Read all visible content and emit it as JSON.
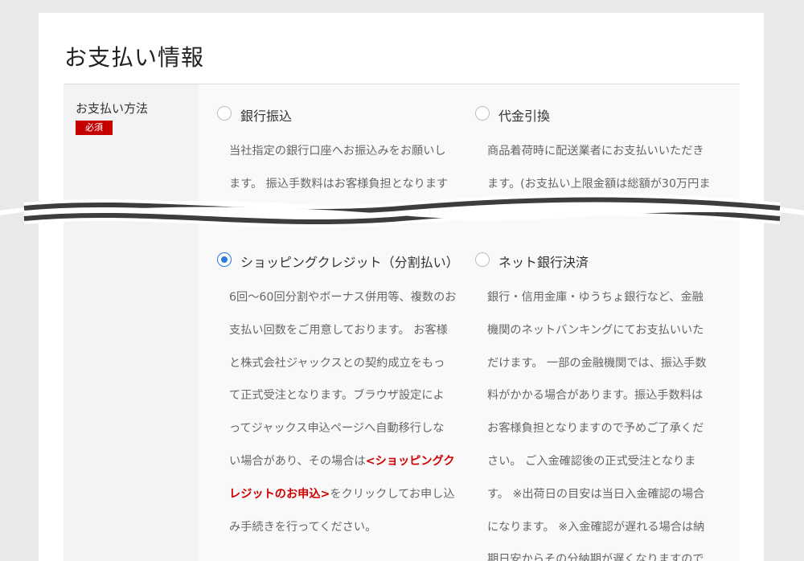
{
  "page": {
    "title": "お支払い情報"
  },
  "form": {
    "field_label": "お支払い方法",
    "required_badge": "必須"
  },
  "options": {
    "bank_transfer": {
      "title": "銀行振込",
      "checked": false,
      "desc": [
        "当社指定の銀行口座へお振込みをお願いし",
        "ます。 振込手数料はお客様負担となります"
      ]
    },
    "cod": {
      "title": "代金引換",
      "checked": false,
      "desc": [
        "商品着荷時に配送業者にお支払いいただき",
        "ます。(お支払い上限金額は総額が30万円ま"
      ]
    },
    "shopping_credit": {
      "title": "ショッピングクレジット（分割払い）",
      "checked": true,
      "desc": [
        "6回～60回分割やボーナス併用等、複数のお",
        "支払い回数をご用意しております。 お客様",
        "と株式会社ジャックスとの契約成立をもっ",
        "て正式受注となります。ブラウザ設定によ",
        "ってジャックス申込ページへ自動移行しな"
      ],
      "desc_line6_before": "い場合があり、その場合は",
      "link_part1": "<ショッピングク",
      "link_part2": "レジットのお申込>",
      "desc_line7_after": "をクリックしてお申し込",
      "desc_line8": "み手続きを行ってください。"
    },
    "net_bank": {
      "title": "ネット銀行決済",
      "checked": false,
      "desc": [
        "銀行・信用金庫・ゆうちょ銀行など、金融",
        "機関のネットバンキングにてお支払いいた",
        "だけます。 一部の金融機関では、振込手数",
        "料がかかる場合があります。振込手数料は",
        "お客様負担となりますので予めご了承くだ",
        "さい。 ご入金確認後の正式受注となりま",
        "す。 ※出荷日の目安は当日入金確認の場合",
        "になります。 ※入金確認が遅れる場合は納",
        "期日安からその分納期が遅くなりますので"
      ]
    }
  }
}
